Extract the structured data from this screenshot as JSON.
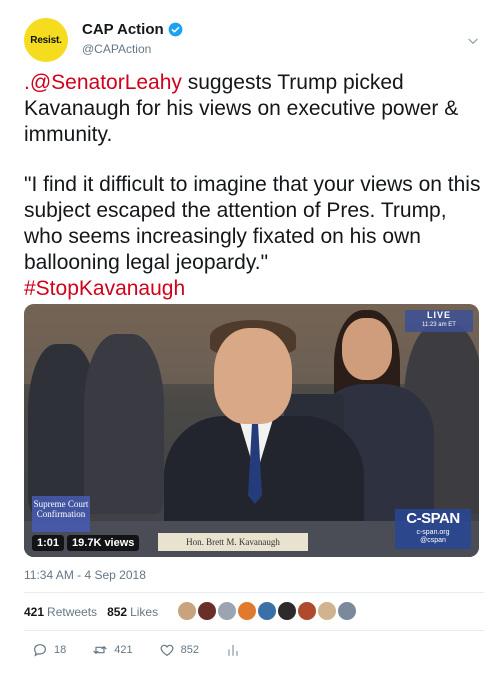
{
  "account": {
    "avatar_text": "Resist.",
    "display_name": "CAP Action",
    "handle": "@CAPAction",
    "verified": true
  },
  "tweet": {
    "mention": ".@SenatorLeahy",
    "text_1": " suggests Trump picked Kavanaugh for his views on executive power & immunity.",
    "quote": "\"I find it difficult to imagine that your views on this subject escaped the attention of Pres. Trump, who seems increasingly fixated on his own ballooning legal jeopardy.\"",
    "hashtag": "#StopKavanaugh"
  },
  "media": {
    "live_label": "LIVE",
    "live_time": "11:23 am ET",
    "supreme_court_label": "Supreme Court Confirmation",
    "network_name": "C-SPAN",
    "network_url": "c-span.org",
    "network_handle": "@cspan",
    "duration": "1:01",
    "views": "19.7K views",
    "nameplate": "Hon. Brett M. Kavanaugh"
  },
  "timestamp": "11:34 AM - 4 Sep 2018",
  "stats": {
    "retweets_count": "421",
    "retweets_label": "Retweets",
    "likes_count": "852",
    "likes_label": "Likes"
  },
  "actions": {
    "replies": "18",
    "retweets": "421",
    "likes": "852"
  },
  "colors": {
    "link": "#d0021b",
    "verified": "#1da1f2",
    "muted": "#657786"
  }
}
